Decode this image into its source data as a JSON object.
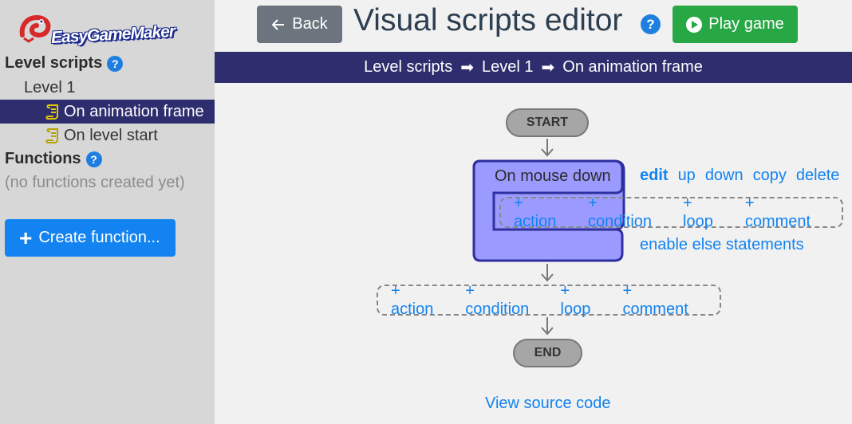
{
  "app": {
    "logo_text": "EasyGameMaker"
  },
  "sidebar": {
    "level_scripts_heading": "Level scripts",
    "level_item": "Level 1",
    "scripts": [
      {
        "label": "On animation frame",
        "active": true
      },
      {
        "label": "On level start",
        "active": false
      }
    ],
    "functions_heading": "Functions",
    "no_functions_text": "(no functions created yet)",
    "create_function_label": "Create function...",
    "help_glyph": "?"
  },
  "header": {
    "back_label": "Back",
    "title": "Visual scripts editor",
    "help_glyph": "?",
    "play_label": "Play game"
  },
  "breadcrumb": {
    "items": [
      "Level scripts",
      "Level 1",
      "On animation frame"
    ],
    "separator": "➡"
  },
  "flow": {
    "start_label": "START",
    "end_label": "END",
    "condition": {
      "label": "On mouse down",
      "actions": [
        "edit",
        "up",
        "down",
        "copy",
        "delete"
      ],
      "inner_add": [
        "+ action",
        "+ condition",
        "+ loop",
        "+ comment"
      ],
      "else_link": "enable else statements"
    },
    "outer_add": [
      "+ action",
      "+ condition",
      "+ loop",
      "+ comment"
    ]
  },
  "footer": {
    "view_source_label": "View source code"
  },
  "colors": {
    "sidebar_bg": "#d7d7d7",
    "navy": "#2e2d6e",
    "link_blue": "#1283f0",
    "condition_fill": "#9b9bff",
    "condition_border": "#2f2fa0",
    "play_green": "#28a745",
    "back_gray": "#6c757d"
  }
}
